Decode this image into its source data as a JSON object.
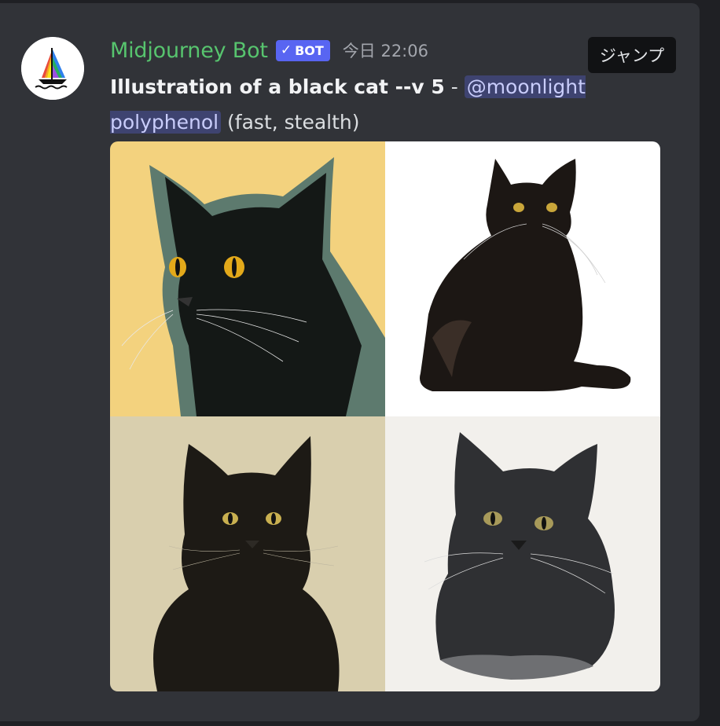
{
  "message": {
    "author": "Midjourney Bot",
    "badge": "BOT",
    "badge_check": "✓",
    "timestamp": "今日 22:06",
    "prompt": "Illustration of a black cat --v 5",
    "separator": " - ",
    "mention": "@moonlight polyphenol",
    "suffix": " (fast, stealth)"
  },
  "hover_actions": {
    "jump_label": "ジャンプ"
  },
  "colors": {
    "author_name": "#57c46e",
    "badge_bg": "#5865f2",
    "mention_bg": "#3e4370",
    "background": "#313338"
  },
  "image_grid": {
    "tiles": [
      {
        "name": "cat-yellow-background-closeup"
      },
      {
        "name": "cat-white-background-sitting"
      },
      {
        "name": "cat-beige-background-portrait"
      },
      {
        "name": "cat-watercolor-sketch"
      }
    ]
  }
}
